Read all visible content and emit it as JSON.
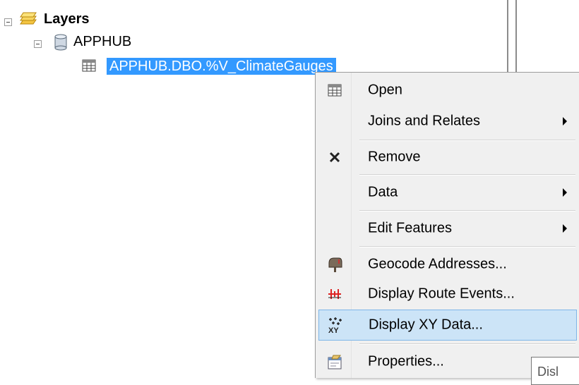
{
  "tree": {
    "root_label": "Layers",
    "db_label": "APPHUB",
    "selected_item_label": "APPHUB.DBO.%V_ClimateGauges"
  },
  "menu": {
    "items": [
      {
        "label": "Open",
        "icon": "table-icon",
        "submenu": false
      },
      {
        "label": "Joins and Relates",
        "icon": "",
        "submenu": true
      },
      {
        "label": "Remove",
        "icon": "remove-x-icon",
        "submenu": false
      },
      {
        "label": "Data",
        "icon": "",
        "submenu": true
      },
      {
        "label": "Edit Features",
        "icon": "",
        "submenu": true
      },
      {
        "label": "Geocode Addresses...",
        "icon": "mailbox-icon",
        "submenu": false
      },
      {
        "label": "Display Route Events...",
        "icon": "route-events-icon",
        "submenu": false
      },
      {
        "label": "Display XY Data...",
        "icon": "xy-data-icon",
        "submenu": false,
        "highlighted": true
      },
      {
        "label": "Properties...",
        "icon": "properties-icon",
        "submenu": false
      }
    ]
  },
  "tooltip": {
    "text": "Disl"
  },
  "colors": {
    "selection": "#3399ff",
    "menu_background": "#f0f0f0",
    "menu_highlight": "#cce4f7",
    "menu_highlight_border": "#7fb6e8"
  }
}
